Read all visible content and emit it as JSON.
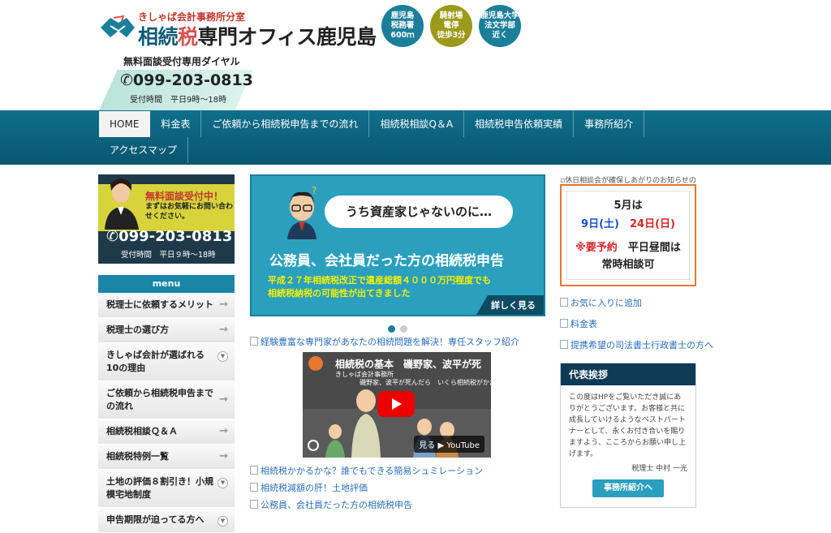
{
  "header": {
    "logo_sub": "きしゃば会計事務所分室",
    "logo_main_a": "相続",
    "logo_main_b": "税",
    "logo_main_c": "専門",
    "logo_main_d": "オフィス鹿児島",
    "badges": [
      {
        "l1": "鹿児島",
        "l2": "税務署",
        "l3": "600ｍ"
      },
      {
        "l1": "騎射場",
        "l2": "電停",
        "l3": "徒歩3分"
      },
      {
        "l1": "鹿児島大学",
        "l2": "法文学部",
        "l3": "近く"
      }
    ],
    "dial_label": "無料面談受付専用ダイヤル",
    "phone": "099-203-0813",
    "hours": "受付時間　平日9時～18時"
  },
  "nav": {
    "row1": [
      "HOME",
      "料金表",
      "ご依頼から相続税申告までの流れ",
      "相続税相談Q＆A",
      "相続税申告依頼実績",
      "事務所紹介"
    ],
    "row2": [
      "アクセスマップ"
    ]
  },
  "promo": {
    "title": "無料面談受付中！",
    "text": "まずはお気軽にお問い合わせください。",
    "phone": "099-203-0813",
    "hours": "受付時間　平日９時～18時"
  },
  "menu": {
    "heading": "menu",
    "items": [
      {
        "label": "税理士に依頼するメリット",
        "type": "arrow"
      },
      {
        "label": "税理士の選び方",
        "type": "arrow"
      },
      {
        "label": "きしゃば会計が選ばれる10の理由",
        "type": "circle"
      },
      {
        "label": "ご依頼から相続税申告までの流れ",
        "type": "arrow"
      },
      {
        "label": "相続税相談Ｑ＆Ａ",
        "type": "arrow"
      },
      {
        "label": "相続税特例一覧",
        "type": "arrow"
      },
      {
        "label": "土地の評価８割引き！小規模宅地制度",
        "type": "circle"
      },
      {
        "label": "申告期限が迫ってる方へ",
        "type": "circle"
      }
    ]
  },
  "hero": {
    "bubble": "うち資産家じゃないのに…",
    "title": "公務員、会社員だった方の相続税申告",
    "sub1": "平成２７年相続税改正で遺産総額４０００万円程度でも",
    "sub2": "相続税納税の可能性が出てきました",
    "more": "詳しく見る"
  },
  "center_links": {
    "staff": "経験豊富な専門家があなたの相続問題を解決！専任スタッフ紹介",
    "sim": "相続税かかるかな？誰でもできる簡易シュミレーション",
    "land": "相続税減額の肝！土地評価",
    "civil": "公務員、会社員だった方の相続税申告"
  },
  "video": {
    "title": "相続税の基本　磯野家、波平が死",
    "sub1": "きしゃば会計事務所",
    "sub2": "磯野家、波平が死んだら　いくら相続税がかかるか？",
    "watch": "見る ▶ YouTube"
  },
  "right": {
    "img_alt": "休日相談会が確保しあがりのお知らせの",
    "notice_month": "5月は",
    "notice_day1": "9日(土)",
    "notice_day2": "24日(日)",
    "notice_reserve": "※要予約",
    "notice_weekday": "平日昼間は",
    "notice_always": "常時相談可",
    "links": [
      "お気に入りに追加",
      "料金表",
      "提携希望の司法書士行政書士の方へ"
    ],
    "greet_head": "代表挨拶",
    "greet_body": "この度はHPをご覧いただき誠にありがとうございます。お客様と共に成長していけるようなベストパートナーとして、永くお付き合いを賜りますよう、こころからお願い申し上げます。",
    "greet_sign": "税理士 中村 一光",
    "greet_btn": "事務所紹介へ"
  },
  "colors": {
    "nav": "#0f6f8c",
    "accent": "#2aa0be",
    "notice_border": "#e8772e"
  }
}
